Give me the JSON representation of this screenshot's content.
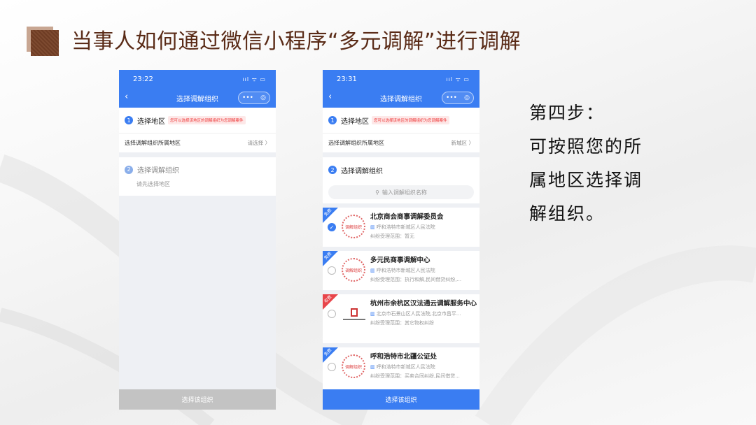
{
  "title": "当事人如何通过微信小程序“多元调解”进行调解",
  "left_phone": {
    "time": "23:22",
    "status_icons": "ııl ᯤ ▭",
    "nav_back": "‹",
    "nav_title": "选择调解组织",
    "capsule_dots": "•••",
    "capsule_close": "◎",
    "step1_num": "1",
    "step1_label": "选择地区",
    "step1_hint": "您可以选择该地区的调解组织为您调解案件",
    "region_label": "选择调解组织所属地区",
    "region_value": "请选择 〉",
    "step2_num": "2",
    "step2_label": "选择调解组织",
    "step2_hint": "请先选择地区",
    "button_label": "选择该组织"
  },
  "right_phone": {
    "time": "23:31",
    "status_icons": "ııl ᯤ ▭",
    "nav_back": "‹",
    "nav_title": "选择调解组织",
    "capsule_dots": "•••",
    "capsule_close": "◎",
    "step1_num": "1",
    "step1_label": "选择地区",
    "step1_hint": "您可以选择该地区的调解组织为您调解案件",
    "region_label": "选择调解组织所属地区",
    "region_value": "新城区 〉",
    "step2_num": "2",
    "step2_label": "选择调解组织",
    "search_placeholder": "输入调解组织名称",
    "orgs": [
      {
        "badge": "免费",
        "name": "北京商会商事调解委员会",
        "court": "呼和浩特市新城区人民法院",
        "scope": "纠纷受理范围：暂无",
        "seal": "调解组织"
      },
      {
        "badge": "免费",
        "name": "多元民商事调解中心",
        "court": "呼和浩特市新城区人民法院",
        "scope": "纠纷受理范围：执行和解,民间借贷纠纷,...",
        "seal": "调解组织"
      },
      {
        "badge": "收费",
        "name": "杭州市余杭区汉法通云调解服务中心",
        "court": "北京市石景山区人民法院,北京市昌平...",
        "scope": "纠纷受理范围：其它物权纠纷"
      },
      {
        "badge": "免费",
        "name": "呼和浩特市北疆公证处",
        "court": "呼和浩特市新城区人民法院",
        "scope": "纠纷受理范围：买卖合同纠纷,民间借贷...",
        "seal": "调解组织"
      }
    ],
    "button_label": "选择该组织"
  },
  "step_text": {
    "line1": "第四步：",
    "line2": "可按照您的所",
    "line3": "属地区选择调",
    "line4": "解组织。"
  },
  "colors": {
    "title": "#5a2b17",
    "accent_blue": "#3a7df2",
    "fee_red": "#e8454a"
  }
}
